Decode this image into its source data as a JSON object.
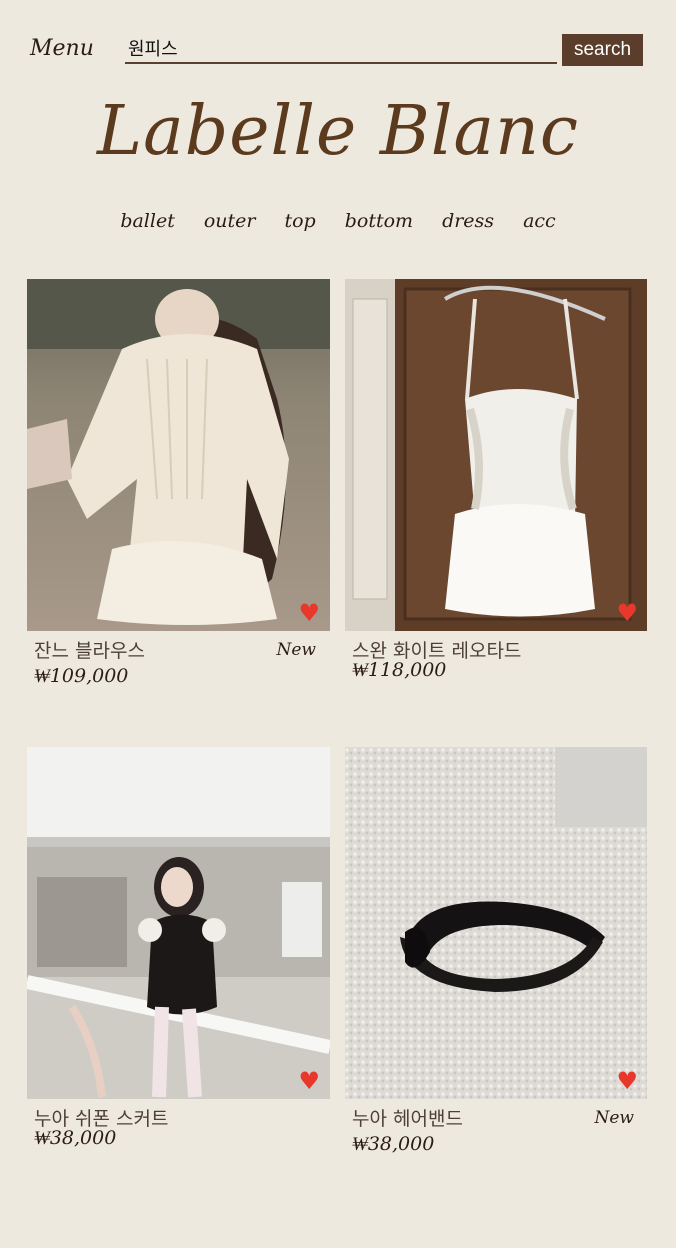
{
  "header": {
    "menu_label": "Menu",
    "search_value": "원피스",
    "search_button": "search"
  },
  "brand": {
    "name": "Labelle Blanc",
    "color": "#5b3a1e"
  },
  "nav": {
    "items": [
      "ballet",
      "outer",
      "top",
      "bottom",
      "dress",
      "acc"
    ]
  },
  "products": [
    {
      "name": "잔느 블라우스",
      "price": "₩109,000",
      "badge": "New",
      "icon": "heart-icon"
    },
    {
      "name": "스완 화이트 레오타드",
      "price": "₩118,000",
      "badge": "",
      "icon": "heart-icon"
    },
    {
      "name": "누아 쉬폰 스커트",
      "price": "₩38,000",
      "badge": "",
      "icon": "heart-icon"
    },
    {
      "name": "누아 헤어밴드",
      "price": "₩38,000",
      "badge": "New",
      "icon": "heart-icon"
    }
  ],
  "colors": {
    "background": "#eee9df",
    "button": "#5a3e2b",
    "heart": "#e8382c"
  }
}
